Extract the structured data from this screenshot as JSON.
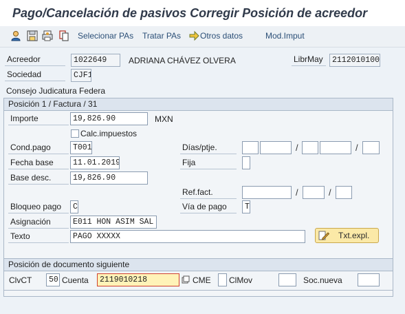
{
  "title": "Pago/Cancelación de pasivos Corregir Posición de acreedor",
  "toolbar": {
    "icons": [
      "person-icon",
      "save-icon",
      "print-icon",
      "copy-icon"
    ],
    "seleccionar_pas": "Selecionar PAs",
    "tratar_pas": "Tratar PAs",
    "otros_datos": "Otros datos",
    "mod_imput": "Mod.Imput"
  },
  "header": {
    "acreedor_label": "Acreedor",
    "acreedor_value": "1022649",
    "acreedor_name": "ADRIANA CHÁVEZ OLVERA",
    "librmay_label": "LibrMay",
    "librmay_value": "2112010100",
    "sociedad_label": "Sociedad",
    "sociedad_value": "CJF1",
    "sociedad_name": "Consejo Judicatura Federa"
  },
  "position": {
    "header": "Posición 1 / Factura / 31",
    "importe_label": "Importe",
    "importe_value": "19,826.90",
    "currency": "MXN",
    "calc_impuestos_label": "Calc.impuestos",
    "cond_pago_label": "Cond.pago",
    "cond_pago_value": "T001",
    "dias_ptje_label": "Días/ptje.",
    "fecha_base_label": "Fecha base",
    "fecha_base_value": "11.01.2019",
    "fija_label": "Fija",
    "base_desc_label": "Base desc.",
    "base_desc_value": "19,826.90",
    "ref_fact_label": "Ref.fact.",
    "bloqueo_pago_label": "Bloqueo pago",
    "bloqueo_pago_value": "C",
    "via_pago_label": "Vía de pago",
    "via_pago_value": "T",
    "asignacion_label": "Asignación",
    "asignacion_value": "E011 HON ASIM SAL",
    "texto_label": "Texto",
    "texto_value": "PAGO XXXXX",
    "txt_expl_label": "Txt.expl."
  },
  "next_doc": {
    "header": "Posición de documento siguiente",
    "clvct_label": "ClvCT",
    "clvct_value": "50",
    "cuenta_label": "Cuenta",
    "cuenta_value": "2119010218",
    "cme_label": "CME",
    "clmov_label": "ClMov",
    "soc_nueva_label": "Soc.nueva"
  },
  "colors": {
    "title_text": "#303a4a",
    "link_text": "#2b4f77",
    "highlight_field": "#fff3b8",
    "focus_border": "#d0402c",
    "button_bg": "#fbe9a7"
  }
}
